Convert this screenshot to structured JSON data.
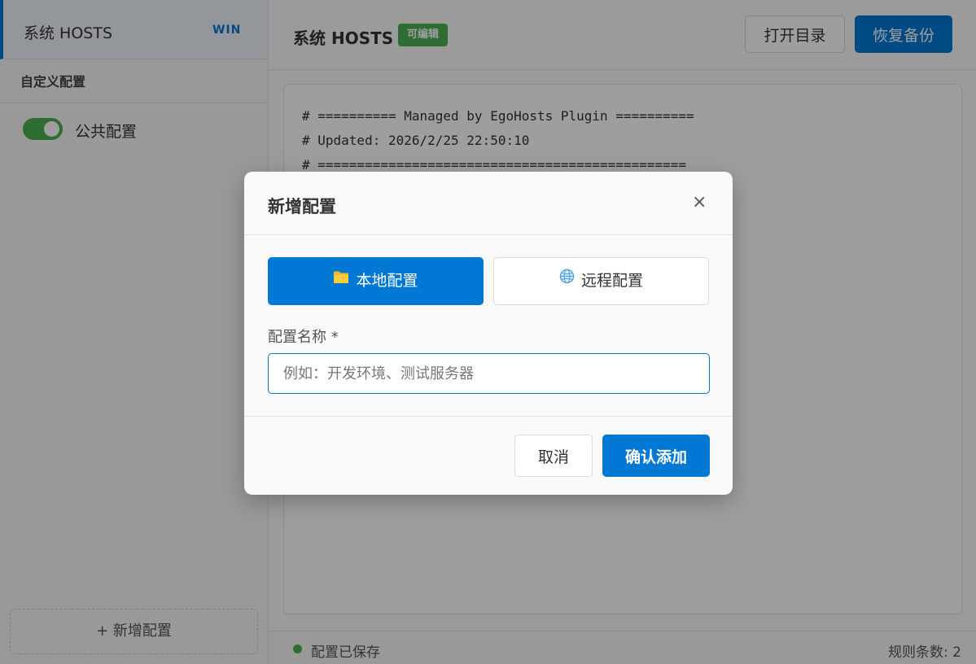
{
  "sidebar": {
    "system_item": {
      "label": "系统 HOSTS",
      "badge": "WIN"
    },
    "section_title": "自定义配置",
    "configs": [
      {
        "name": "公共配置",
        "enabled": true
      }
    ],
    "add_button": "+ 新增配置"
  },
  "header": {
    "title": "系统 HOSTS",
    "editable_badge": "可编辑",
    "open_dir": "打开目录",
    "restore_backup": "恢复备份"
  },
  "editor": {
    "lines": [
      "# ========== Managed by EgoHosts Plugin ==========",
      "# Updated: 2026/2/25 22:50:10",
      "# ==============================================="
    ]
  },
  "status": {
    "saved": "配置已保存",
    "rule_count": "规则条数: 2"
  },
  "modal": {
    "title": "新增配置",
    "close": "×",
    "type_local": "本地配置",
    "type_remote": "远程配置",
    "field_label": "配置名称 *",
    "field_placeholder": "例如：开发环境、测试服务器",
    "field_value": "",
    "cancel": "取消",
    "confirm": "确认添加"
  },
  "colors": {
    "accent": "#0078d4",
    "success": "#4caf50"
  },
  "icons": {
    "local": "folder-icon",
    "remote": "globe-icon",
    "close": "close-icon"
  }
}
